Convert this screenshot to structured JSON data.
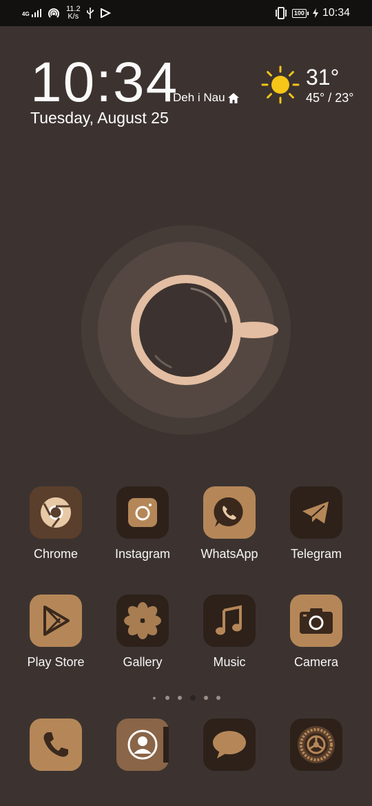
{
  "status_bar": {
    "network": "4G",
    "speed_value": "11.2",
    "speed_unit": "K/s",
    "battery": "100",
    "time": "10:34"
  },
  "widget": {
    "time": "10:34",
    "location": "Deh i Nau",
    "date": "Tuesday, August 25",
    "temperature": "31°",
    "temp_range": "45° / 23°",
    "weather_icon": "sun-icon",
    "sun_color": "#f5c518"
  },
  "apps": [
    {
      "label": "Chrome",
      "icon": "chrome-icon"
    },
    {
      "label": "Instagram",
      "icon": "instagram-icon"
    },
    {
      "label": "WhatsApp",
      "icon": "whatsapp-icon"
    },
    {
      "label": "Telegram",
      "icon": "telegram-icon"
    },
    {
      "label": "Play Store",
      "icon": "play-store-icon"
    },
    {
      "label": "Gallery",
      "icon": "gallery-icon"
    },
    {
      "label": "Music",
      "icon": "music-icon"
    },
    {
      "label": "Camera",
      "icon": "camera-icon"
    }
  ],
  "dock": [
    {
      "icon": "phone-icon"
    },
    {
      "icon": "contacts-icon"
    },
    {
      "icon": "messages-icon"
    },
    {
      "icon": "settings-icon"
    }
  ],
  "page_indicator": {
    "count": 6,
    "active_index": 3
  },
  "colors": {
    "background": "#3c3330",
    "icon_dark": "#2d211a",
    "icon_brown": "#5a3f2c",
    "icon_tan": "#b58758",
    "cup": "#e3bea3"
  }
}
